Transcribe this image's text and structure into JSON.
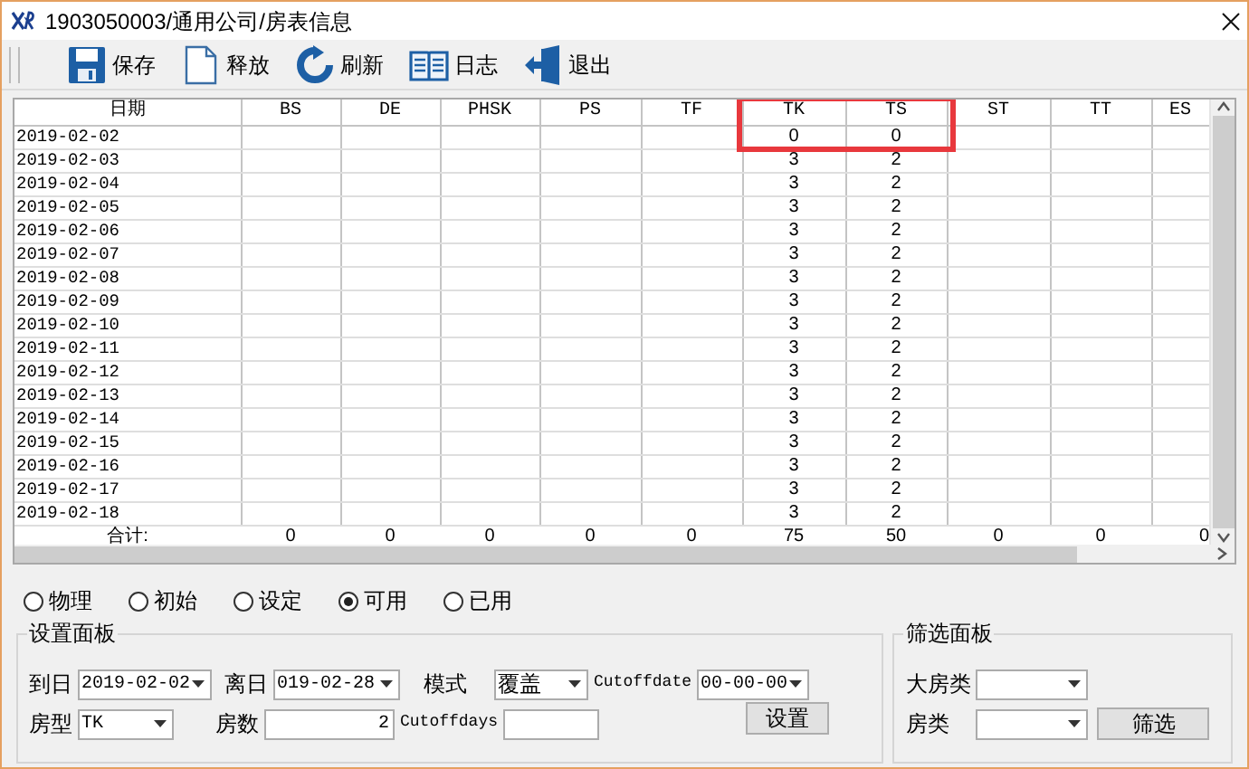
{
  "window": {
    "title": "1903050003/通用公司/房表信息"
  },
  "toolbar": [
    {
      "label": "保存",
      "kind": "save"
    },
    {
      "label": "释放",
      "kind": "document"
    },
    {
      "label": "刷新",
      "kind": "refresh"
    },
    {
      "label": "日志",
      "kind": "log"
    },
    {
      "label": "退出",
      "kind": "exit"
    }
  ],
  "table": {
    "columns": [
      {
        "label": "日期",
        "highlighted": false
      },
      {
        "label": "BS",
        "highlighted": false
      },
      {
        "label": "DE",
        "highlighted": false
      },
      {
        "label": "PHSK",
        "highlighted": false
      },
      {
        "label": "PS",
        "highlighted": false
      },
      {
        "label": "TF",
        "highlighted": false
      },
      {
        "label": "TK",
        "highlighted": true
      },
      {
        "label": "TS",
        "highlighted": true
      },
      {
        "label": "ST",
        "highlighted": false
      },
      {
        "label": "TT",
        "highlighted": false
      },
      {
        "label": "ES",
        "highlighted": false
      }
    ],
    "rows": [
      {
        "date": "2019-02-02",
        "tk": "0",
        "ts": "0"
      },
      {
        "date": "2019-02-03",
        "tk": "3",
        "ts": "2"
      },
      {
        "date": "2019-02-04",
        "tk": "3",
        "ts": "2"
      },
      {
        "date": "2019-02-05",
        "tk": "3",
        "ts": "2"
      },
      {
        "date": "2019-02-06",
        "tk": "3",
        "ts": "2"
      },
      {
        "date": "2019-02-07",
        "tk": "3",
        "ts": "2"
      },
      {
        "date": "2019-02-08",
        "tk": "3",
        "ts": "2"
      },
      {
        "date": "2019-02-09",
        "tk": "3",
        "ts": "2"
      },
      {
        "date": "2019-02-10",
        "tk": "3",
        "ts": "2"
      },
      {
        "date": "2019-02-11",
        "tk": "3",
        "ts": "2"
      },
      {
        "date": "2019-02-12",
        "tk": "3",
        "ts": "2"
      },
      {
        "date": "2019-02-13",
        "tk": "3",
        "ts": "2"
      },
      {
        "date": "2019-02-14",
        "tk": "3",
        "ts": "2"
      },
      {
        "date": "2019-02-15",
        "tk": "3",
        "ts": "2"
      },
      {
        "date": "2019-02-16",
        "tk": "3",
        "ts": "2"
      },
      {
        "date": "2019-02-17",
        "tk": "3",
        "ts": "2"
      },
      {
        "date": "2019-02-18",
        "tk": "3",
        "ts": "2"
      }
    ],
    "totals": {
      "label": "合计:",
      "values": [
        "0",
        "0",
        "0",
        "0",
        "0",
        "75",
        "50",
        "0",
        "0",
        "0"
      ]
    }
  },
  "view_options": [
    {
      "label": "物理",
      "selected": false
    },
    {
      "label": "初始",
      "selected": false
    },
    {
      "label": "设定",
      "selected": false
    },
    {
      "label": "可用",
      "selected": true
    },
    {
      "label": "已用",
      "selected": false
    }
  ],
  "settings_panel": {
    "title": "设置面板",
    "arrive": {
      "label": "到日",
      "value": "2019-02-02"
    },
    "depart": {
      "label": "离日",
      "value": "019-02-28"
    },
    "mode": {
      "label": "模式",
      "value": "覆盖"
    },
    "cutoff_date": {
      "label": "Cutoffdate",
      "value": "00-00-00"
    },
    "room_type": {
      "label": "房型",
      "value": "TK"
    },
    "room_count": {
      "label": "房数",
      "value": "2"
    },
    "cutoff_days": {
      "label": "Cutoffdays"
    },
    "button": "设置"
  },
  "filter_panel": {
    "title": "筛选面板",
    "category": {
      "label": "大房类"
    },
    "room_class": {
      "label": "房类"
    },
    "button": "筛选"
  }
}
